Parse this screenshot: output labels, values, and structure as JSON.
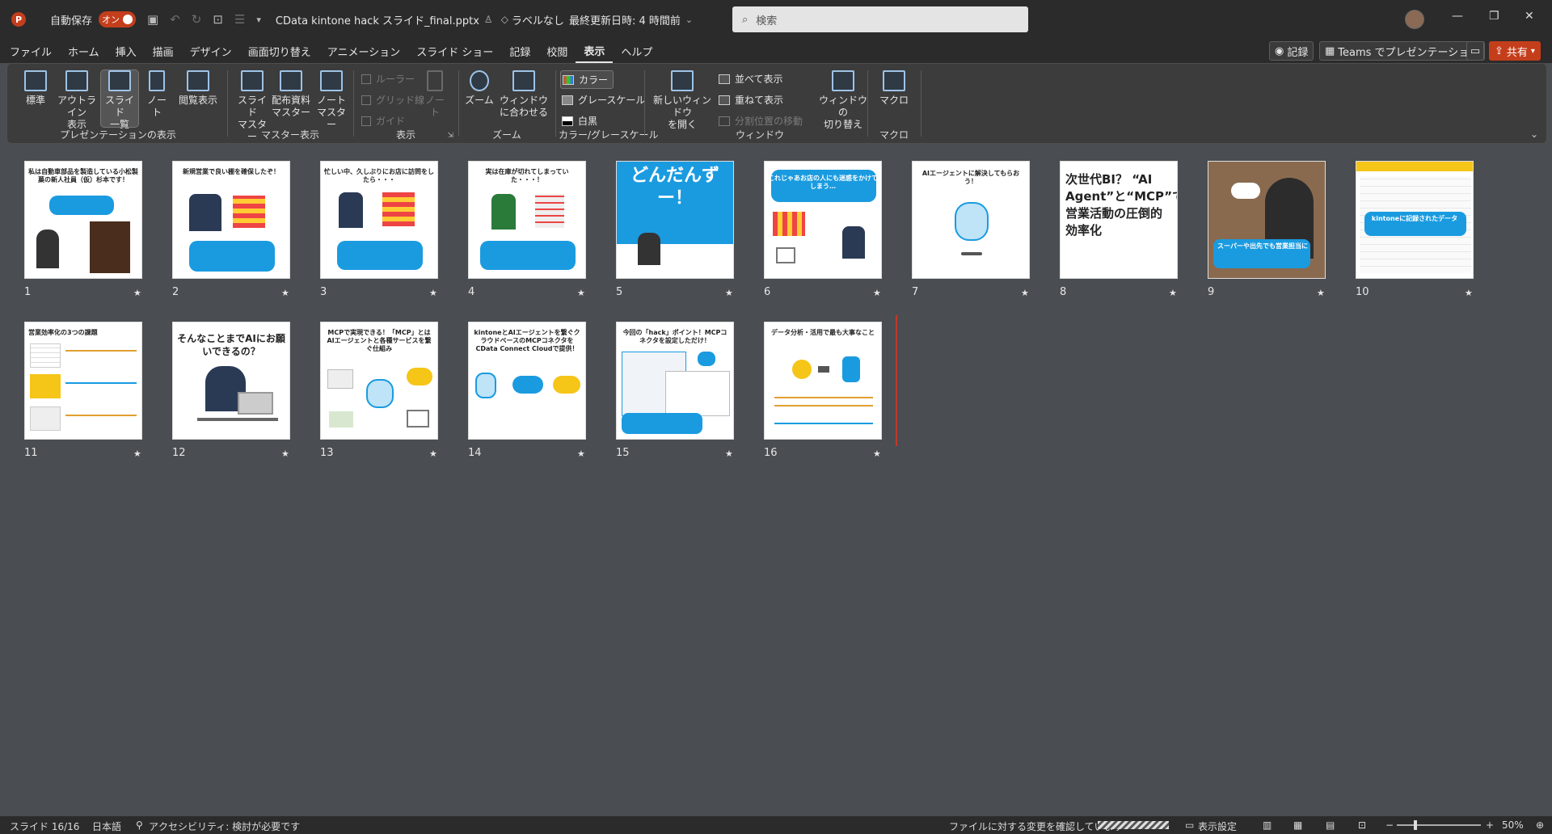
{
  "titlebar": {
    "autosave_label": "自動保存",
    "autosave_state": "オン",
    "filename": "CData kintone hack スライド_final.pptx",
    "label_status": "ラベルなし",
    "last_updated": "最終更新日時: 4 時間前"
  },
  "search": {
    "placeholder": "検索"
  },
  "menu": {
    "items": [
      "ファイル",
      "ホーム",
      "挿入",
      "描画",
      "デザイン",
      "画面切り替え",
      "アニメーション",
      "スライド ショー",
      "記録",
      "校閲",
      "表示",
      "ヘルプ"
    ],
    "active": "表示"
  },
  "right_buttons": {
    "record": "記録",
    "teams": "Teams でプレゼンテーション",
    "share": "共有"
  },
  "ribbon": {
    "presentation_views": {
      "label": "プレゼンテーションの表示",
      "normal": "標準",
      "outline": "アウトライン\n表示",
      "slide_sorter": "スライド\n一覧",
      "notes": "ノー\nト",
      "reading": "閲覧表示"
    },
    "master_views": {
      "label": "マスター表示",
      "slide_master": "スライド\nマスター",
      "handout_master": "配布資料\nマスター",
      "notes_master": "ノート\nマスター"
    },
    "show": {
      "label": "表示",
      "ruler": "ルーラー",
      "gridlines": "グリッド線",
      "guides": "ガイド",
      "notes": "ノー\nト"
    },
    "zoom": {
      "label": "ズーム",
      "zoom": "ズーム",
      "fit": "ウィンドウ\nに合わせる"
    },
    "color": {
      "label": "カラー/グレースケール",
      "color": "カラー",
      "grayscale": "グレースケール",
      "bw": "白黒"
    },
    "window": {
      "label": "ウィンドウ",
      "new_window": "新しいウィンドウ\nを開く",
      "arrange": "並べて表示",
      "cascade": "重ねて表示",
      "split": "分割位置の移動",
      "switch": "ウィンドウの\n切り替え"
    },
    "macros": {
      "label": "マクロ",
      "macros": "マクロ"
    }
  },
  "slides": [
    {
      "num": "1",
      "text": "私は自動車部品を製造している小松製菓の新人社員（仮）杉本です！"
    },
    {
      "num": "2",
      "text": "新規営業で良い棚を確保したぞ！"
    },
    {
      "num": "3",
      "text": "忙しい中、久しぶりにお店に訪問をしたら・・・"
    },
    {
      "num": "4",
      "text": "実は在庫が切れてしまっていた・・・！"
    },
    {
      "num": "5",
      "text": "どんだんずー！"
    },
    {
      "num": "6",
      "text": "これじゃあお店の人にも迷惑をかけてしまう…"
    },
    {
      "num": "7",
      "text": "AIエージェントに解決してもらおう！"
    },
    {
      "num": "8",
      "text": "次世代BI？ “AI Agent”と“MCP”で営業活動の圧倒的効率化"
    },
    {
      "num": "9",
      "text": "スーパーや出先でも営業担当に"
    },
    {
      "num": "10",
      "text": "kintoneに記録されたデータ"
    },
    {
      "num": "11",
      "text": "営業効率化の3つの課題"
    },
    {
      "num": "12",
      "text": "そんなことまでAIにお願いできるの？"
    },
    {
      "num": "13",
      "text": "MCPで実現できる！「MCP」とはAIエージェントと各種サービスを繋ぐ仕組み"
    },
    {
      "num": "14",
      "text": "kintoneとAIエージェントを繋ぐクラウドベースのMCPコネクタをCData Connect Cloudで提供！"
    },
    {
      "num": "15",
      "text": "今回の「hack」ポイント！MCPコネクタを設定しただけ！"
    },
    {
      "num": "16",
      "text": "データ分析・活用で最も大事なこと"
    }
  ],
  "status": {
    "slide_position": "スライド 16/16",
    "language": "日本語",
    "accessibility": "アクセシビリティ: 検討が必要です",
    "sync": "ファイルに対する変更を確認しています",
    "display_settings": "表示設定",
    "zoom": "50%",
    "zoom_fraction": 0.5
  }
}
